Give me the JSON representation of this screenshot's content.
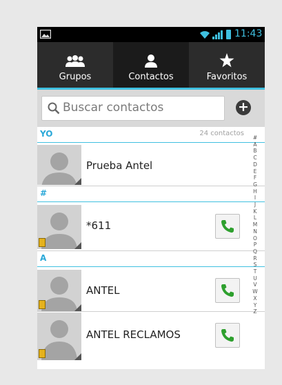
{
  "status_bar": {
    "time": "11:43"
  },
  "tabs": [
    {
      "label": "Grupos",
      "icon": "groups-icon"
    },
    {
      "label": "Contactos",
      "icon": "person-icon",
      "active": true
    },
    {
      "label": "Favoritos",
      "icon": "star-icon"
    }
  ],
  "search": {
    "placeholder": "Buscar contactos"
  },
  "sections": {
    "me": {
      "title": "YO",
      "count": "24 contactos"
    },
    "hash": {
      "title": "#"
    },
    "a": {
      "title": "A"
    }
  },
  "contacts": [
    {
      "name": "Prueba Antel"
    },
    {
      "name": "*611"
    },
    {
      "name": "ANTEL"
    },
    {
      "name": "ANTEL RECLAMOS"
    }
  ],
  "index": [
    "#",
    "A",
    "B",
    "C",
    "D",
    "E",
    "F",
    "G",
    "H",
    "I",
    "J",
    "K",
    "L",
    "M",
    "N",
    "O",
    "P",
    "Q",
    "R",
    "S",
    "T",
    "U",
    "V",
    "W",
    "X",
    "Y",
    "Z"
  ],
  "colors": {
    "accent": "#3fc0e0",
    "call_green": "#2ea02e",
    "tab_bg": "#2c2c2c"
  }
}
